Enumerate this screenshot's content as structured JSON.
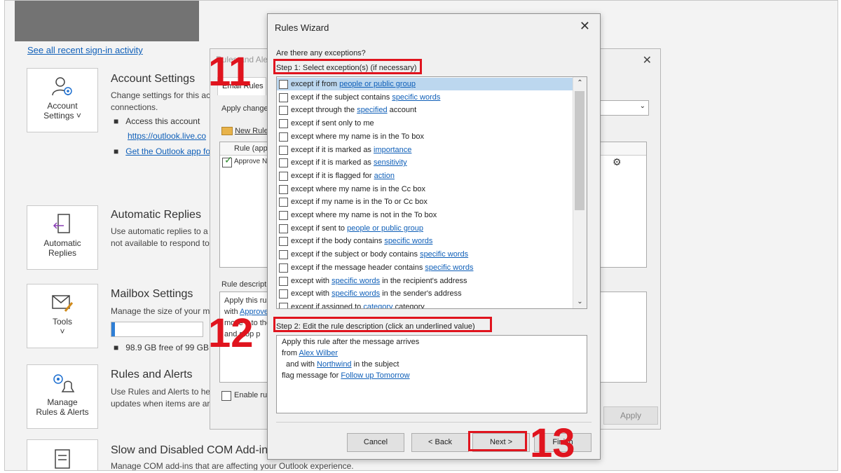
{
  "background_page": {
    "signin_link": "See all recent sign-in activity",
    "account": {
      "tile_label_1": "Account",
      "tile_label_2": "Settings ˅",
      "title": "Account Settings",
      "desc_1": "Change settings for this ac",
      "desc_2": "connections.",
      "bullet_1": "Access this account",
      "bullet_1_link": "https://outlook.live.co",
      "bullet_2_link": "Get the Outlook app fo"
    },
    "auto_replies": {
      "tile_label_1": "Automatic",
      "tile_label_2": "Replies",
      "title": "Automatic Replies",
      "desc_1": "Use automatic replies to a",
      "desc_2": "not available to respond to"
    },
    "mailbox": {
      "tile_label_1": "Tools",
      "tile_label_2": "˅",
      "title": "Mailbox Settings",
      "desc_1": "Manage the size of your m",
      "storage_fill": 0.04,
      "storage_text": "98.9 GB free of 99 GB"
    },
    "rules": {
      "tile_label_1": "Manage",
      "tile_label_2": "Rules & Alerts",
      "title": "Rules and Alerts",
      "desc_1": "Use Rules and Alerts to he",
      "desc_2": "updates when items are ar"
    },
    "com": {
      "title": "Slow and Disabled COM Add-ins",
      "desc_1": "Manage COM add-ins that are affecting your Outlook experience."
    }
  },
  "rules_dialog": {
    "title": "Rules and Alerts",
    "tab": "Email Rules",
    "apply_changes": "Apply change",
    "new_rule": "New Rule",
    "column_rule": "Rule (appl",
    "rule_row": "Approve No",
    "rule_description_label": "Rule descriptio",
    "desc_line_1": "Apply this rul",
    "desc_line_2_pre": "with ",
    "desc_line_2_link": "Approve",
    "desc_line_3": "move it to the",
    "desc_line_4": "and stop p",
    "enable_rules": "Enable rule",
    "apply_button": "Apply"
  },
  "wizard": {
    "title": "Rules Wizard",
    "question": "Are there any exceptions?",
    "step1": "Step 1: Select exception(s) (if necessary)",
    "exceptions": [
      {
        "pre": "except if from ",
        "link": "people or public group",
        "post": "",
        "selected": true
      },
      {
        "pre": "except if the subject contains ",
        "link": "specific words",
        "post": ""
      },
      {
        "pre": "except through the ",
        "link": "specified",
        "post": " account"
      },
      {
        "pre": "except if sent only to me",
        "link": "",
        "post": ""
      },
      {
        "pre": "except where my name is in the To box",
        "link": "",
        "post": ""
      },
      {
        "pre": "except if it is marked as ",
        "link": "importance",
        "post": ""
      },
      {
        "pre": "except if it is marked as ",
        "link": "sensitivity",
        "post": ""
      },
      {
        "pre": "except if it is flagged for ",
        "link": "action",
        "post": ""
      },
      {
        "pre": "except where my name is in the Cc box",
        "link": "",
        "post": ""
      },
      {
        "pre": "except if my name is in the To or Cc box",
        "link": "",
        "post": ""
      },
      {
        "pre": "except where my name is not in the To box",
        "link": "",
        "post": ""
      },
      {
        "pre": "except if sent to ",
        "link": "people or public group",
        "post": ""
      },
      {
        "pre": "except if the body contains ",
        "link": "specific words",
        "post": ""
      },
      {
        "pre": "except if the subject or body contains ",
        "link": "specific words",
        "post": ""
      },
      {
        "pre": "except if the message header contains ",
        "link": "specific words",
        "post": ""
      },
      {
        "pre": "except with ",
        "link": "specific words",
        "post": " in the recipient's address"
      },
      {
        "pre": "except with ",
        "link": "specific words",
        "post": " in the sender's address"
      },
      {
        "pre": "except if assigned to ",
        "link": "category",
        "post": " category"
      }
    ],
    "step2": "Step 2: Edit the rule description (click an underlined value)",
    "description": {
      "line1": "Apply this rule after the message arrives",
      "line2_pre": "from ",
      "line2_link": "Alex Wilber",
      "line3_pre": "and with ",
      "line3_link": "Northwind",
      "line3_post": " in the subject",
      "line4_pre": "flag message for ",
      "line4_link": "Follow up Tomorrow"
    },
    "buttons": {
      "cancel": "Cancel",
      "back": "< Back",
      "next": "Next >",
      "finish": "Finish"
    }
  },
  "annotations": {
    "step_numbers": [
      "11",
      "12",
      "13"
    ],
    "highlight_color": "#e0141e"
  }
}
